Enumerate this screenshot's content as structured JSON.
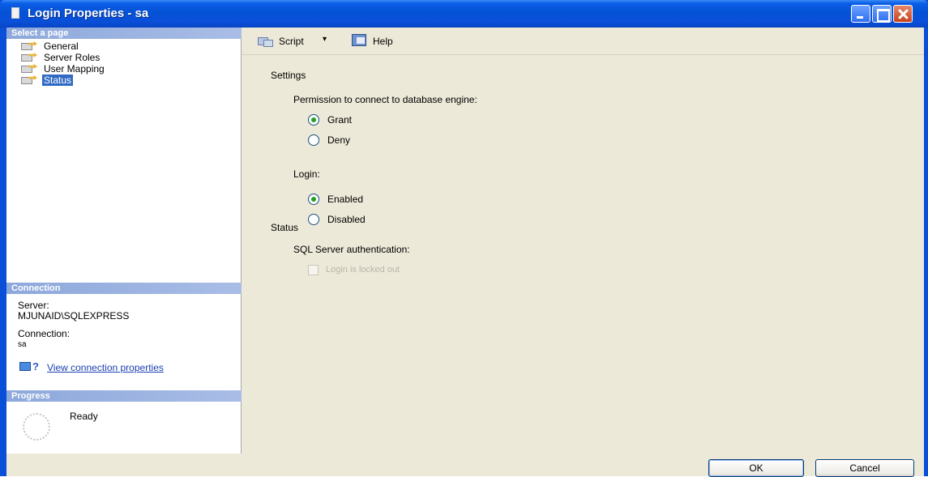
{
  "window": {
    "title": "Login Properties - sa"
  },
  "left": {
    "select_header": "Select a page",
    "pages": [
      {
        "label": "General",
        "selected": false
      },
      {
        "label": "Server Roles",
        "selected": false
      },
      {
        "label": "User Mapping",
        "selected": false
      },
      {
        "label": "Status",
        "selected": true
      }
    ],
    "connection_header": "Connection",
    "server_label": "Server:",
    "server_value": "MJUNAID\\SQLEXPRESS",
    "connection_label": "Connection:",
    "connection_value": "sa",
    "view_link": "View connection properties",
    "progress_header": "Progress",
    "progress_status": "Ready"
  },
  "toolbar": {
    "script_label": "Script",
    "dropdown_glyph": "▾",
    "help_label": "Help"
  },
  "settings": {
    "title": "Settings",
    "permission_label": "Permission to connect to database engine:",
    "grant_label": "Grant",
    "deny_label": "Deny",
    "permission_selected": "Grant",
    "login_label": "Login:",
    "enabled_label": "Enabled",
    "disabled_label": "Disabled",
    "login_selected": "Enabled"
  },
  "status": {
    "title": "Status",
    "sql_auth_label": "SQL Server authentication:",
    "locked_out_label": "Login is locked out",
    "locked_out_checked": false,
    "locked_out_enabled": false
  },
  "buttons": {
    "ok": "OK",
    "cancel": "Cancel"
  },
  "colors": {
    "title_bar": "#0a4fd8",
    "section_header": "#8da8db",
    "selection": "#316ac5",
    "link": "#1a3fb3",
    "dialog_bg": "#ece9d8"
  }
}
